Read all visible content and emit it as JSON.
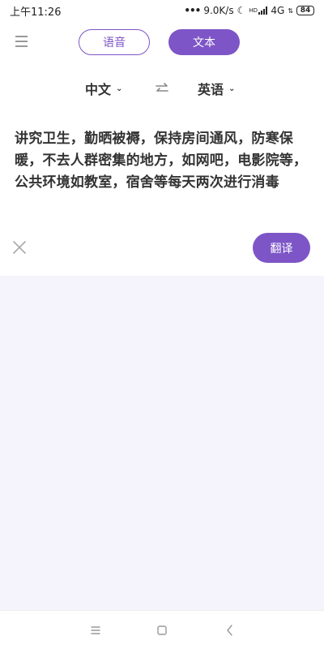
{
  "status_bar": {
    "time": "上午11:26",
    "net_speed": "9.0K/s",
    "hd_label": "HD",
    "network_type": "4G",
    "battery": "84"
  },
  "header": {
    "voice_tab": "语音",
    "text_tab": "文本",
    "active_tab": "文本"
  },
  "languages": {
    "source": "中文",
    "target": "英语"
  },
  "input": {
    "text": "讲究卫生，勤晒被褥，保持房间通风，防寒保暖，不去人群密集的地方，如网吧，电影院等，公共环境如教室，宿舍等每天两次进行消毒"
  },
  "actions": {
    "translate_label": "翻译"
  },
  "colors": {
    "accent": "#7d55c7",
    "result_bg": "#f5f3fb",
    "text": "#333333"
  }
}
